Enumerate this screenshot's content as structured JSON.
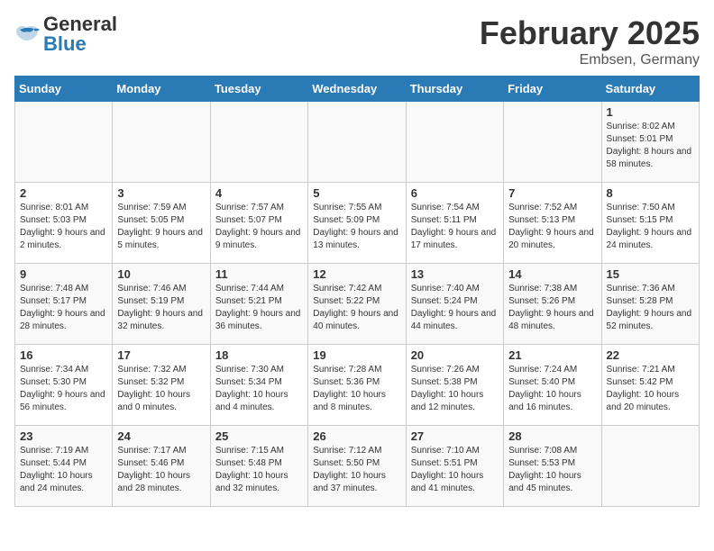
{
  "logo": {
    "text_general": "General",
    "text_blue": "Blue"
  },
  "title": "February 2025",
  "subtitle": "Embsen, Germany",
  "weekdays": [
    "Sunday",
    "Monday",
    "Tuesday",
    "Wednesday",
    "Thursday",
    "Friday",
    "Saturday"
  ],
  "weeks": [
    [
      {
        "day": "",
        "sunrise": "",
        "sunset": "",
        "daylight": ""
      },
      {
        "day": "",
        "sunrise": "",
        "sunset": "",
        "daylight": ""
      },
      {
        "day": "",
        "sunrise": "",
        "sunset": "",
        "daylight": ""
      },
      {
        "day": "",
        "sunrise": "",
        "sunset": "",
        "daylight": ""
      },
      {
        "day": "",
        "sunrise": "",
        "sunset": "",
        "daylight": ""
      },
      {
        "day": "",
        "sunrise": "",
        "sunset": "",
        "daylight": ""
      },
      {
        "day": "1",
        "sunrise": "Sunrise: 8:02 AM",
        "sunset": "Sunset: 5:01 PM",
        "daylight": "Daylight: 8 hours and 58 minutes."
      }
    ],
    [
      {
        "day": "2",
        "sunrise": "Sunrise: 8:01 AM",
        "sunset": "Sunset: 5:03 PM",
        "daylight": "Daylight: 9 hours and 2 minutes."
      },
      {
        "day": "3",
        "sunrise": "Sunrise: 7:59 AM",
        "sunset": "Sunset: 5:05 PM",
        "daylight": "Daylight: 9 hours and 5 minutes."
      },
      {
        "day": "4",
        "sunrise": "Sunrise: 7:57 AM",
        "sunset": "Sunset: 5:07 PM",
        "daylight": "Daylight: 9 hours and 9 minutes."
      },
      {
        "day": "5",
        "sunrise": "Sunrise: 7:55 AM",
        "sunset": "Sunset: 5:09 PM",
        "daylight": "Daylight: 9 hours and 13 minutes."
      },
      {
        "day": "6",
        "sunrise": "Sunrise: 7:54 AM",
        "sunset": "Sunset: 5:11 PM",
        "daylight": "Daylight: 9 hours and 17 minutes."
      },
      {
        "day": "7",
        "sunrise": "Sunrise: 7:52 AM",
        "sunset": "Sunset: 5:13 PM",
        "daylight": "Daylight: 9 hours and 20 minutes."
      },
      {
        "day": "8",
        "sunrise": "Sunrise: 7:50 AM",
        "sunset": "Sunset: 5:15 PM",
        "daylight": "Daylight: 9 hours and 24 minutes."
      }
    ],
    [
      {
        "day": "9",
        "sunrise": "Sunrise: 7:48 AM",
        "sunset": "Sunset: 5:17 PM",
        "daylight": "Daylight: 9 hours and 28 minutes."
      },
      {
        "day": "10",
        "sunrise": "Sunrise: 7:46 AM",
        "sunset": "Sunset: 5:19 PM",
        "daylight": "Daylight: 9 hours and 32 minutes."
      },
      {
        "day": "11",
        "sunrise": "Sunrise: 7:44 AM",
        "sunset": "Sunset: 5:21 PM",
        "daylight": "Daylight: 9 hours and 36 minutes."
      },
      {
        "day": "12",
        "sunrise": "Sunrise: 7:42 AM",
        "sunset": "Sunset: 5:22 PM",
        "daylight": "Daylight: 9 hours and 40 minutes."
      },
      {
        "day": "13",
        "sunrise": "Sunrise: 7:40 AM",
        "sunset": "Sunset: 5:24 PM",
        "daylight": "Daylight: 9 hours and 44 minutes."
      },
      {
        "day": "14",
        "sunrise": "Sunrise: 7:38 AM",
        "sunset": "Sunset: 5:26 PM",
        "daylight": "Daylight: 9 hours and 48 minutes."
      },
      {
        "day": "15",
        "sunrise": "Sunrise: 7:36 AM",
        "sunset": "Sunset: 5:28 PM",
        "daylight": "Daylight: 9 hours and 52 minutes."
      }
    ],
    [
      {
        "day": "16",
        "sunrise": "Sunrise: 7:34 AM",
        "sunset": "Sunset: 5:30 PM",
        "daylight": "Daylight: 9 hours and 56 minutes."
      },
      {
        "day": "17",
        "sunrise": "Sunrise: 7:32 AM",
        "sunset": "Sunset: 5:32 PM",
        "daylight": "Daylight: 10 hours and 0 minutes."
      },
      {
        "day": "18",
        "sunrise": "Sunrise: 7:30 AM",
        "sunset": "Sunset: 5:34 PM",
        "daylight": "Daylight: 10 hours and 4 minutes."
      },
      {
        "day": "19",
        "sunrise": "Sunrise: 7:28 AM",
        "sunset": "Sunset: 5:36 PM",
        "daylight": "Daylight: 10 hours and 8 minutes."
      },
      {
        "day": "20",
        "sunrise": "Sunrise: 7:26 AM",
        "sunset": "Sunset: 5:38 PM",
        "daylight": "Daylight: 10 hours and 12 minutes."
      },
      {
        "day": "21",
        "sunrise": "Sunrise: 7:24 AM",
        "sunset": "Sunset: 5:40 PM",
        "daylight": "Daylight: 10 hours and 16 minutes."
      },
      {
        "day": "22",
        "sunrise": "Sunrise: 7:21 AM",
        "sunset": "Sunset: 5:42 PM",
        "daylight": "Daylight: 10 hours and 20 minutes."
      }
    ],
    [
      {
        "day": "23",
        "sunrise": "Sunrise: 7:19 AM",
        "sunset": "Sunset: 5:44 PM",
        "daylight": "Daylight: 10 hours and 24 minutes."
      },
      {
        "day": "24",
        "sunrise": "Sunrise: 7:17 AM",
        "sunset": "Sunset: 5:46 PM",
        "daylight": "Daylight: 10 hours and 28 minutes."
      },
      {
        "day": "25",
        "sunrise": "Sunrise: 7:15 AM",
        "sunset": "Sunset: 5:48 PM",
        "daylight": "Daylight: 10 hours and 32 minutes."
      },
      {
        "day": "26",
        "sunrise": "Sunrise: 7:12 AM",
        "sunset": "Sunset: 5:50 PM",
        "daylight": "Daylight: 10 hours and 37 minutes."
      },
      {
        "day": "27",
        "sunrise": "Sunrise: 7:10 AM",
        "sunset": "Sunset: 5:51 PM",
        "daylight": "Daylight: 10 hours and 41 minutes."
      },
      {
        "day": "28",
        "sunrise": "Sunrise: 7:08 AM",
        "sunset": "Sunset: 5:53 PM",
        "daylight": "Daylight: 10 hours and 45 minutes."
      },
      {
        "day": "",
        "sunrise": "",
        "sunset": "",
        "daylight": ""
      }
    ]
  ]
}
